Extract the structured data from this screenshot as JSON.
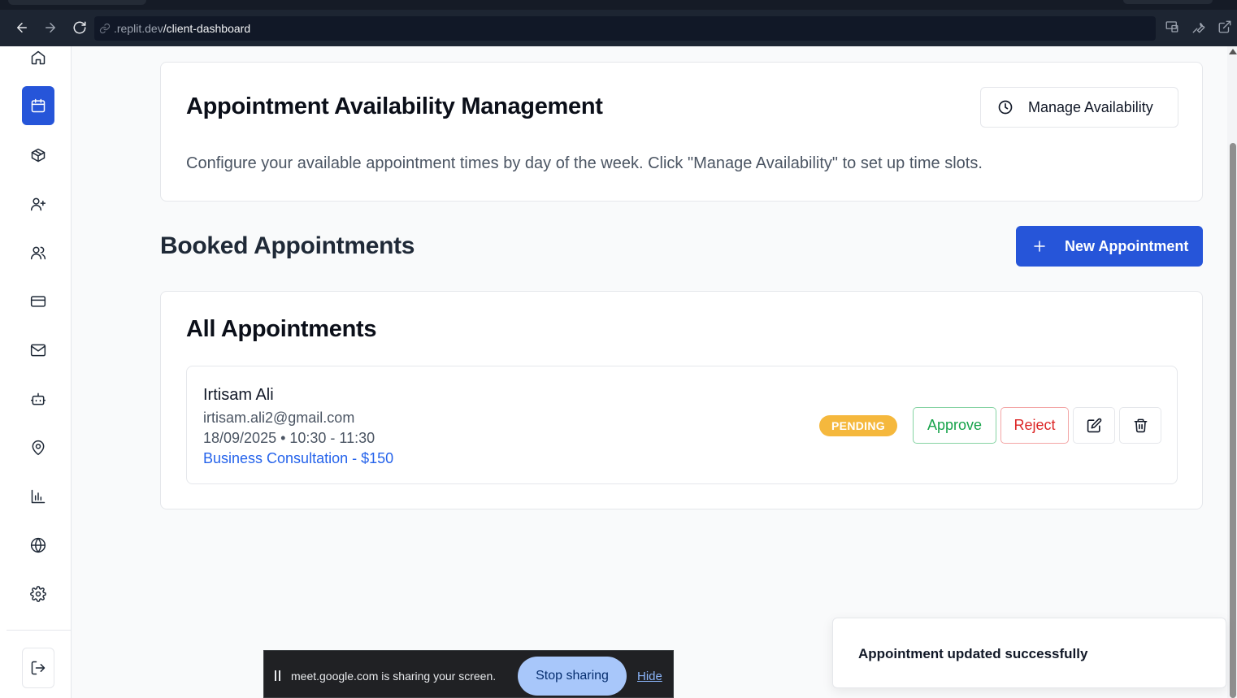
{
  "browser": {
    "url_host": ".replit.dev",
    "url_path": "/client-dashboard"
  },
  "sidebar": {
    "items": [
      {
        "icon": "home-icon",
        "active": false
      },
      {
        "icon": "calendar-icon",
        "active": true
      },
      {
        "icon": "package-icon",
        "active": false
      },
      {
        "icon": "user-plus-icon",
        "active": false
      },
      {
        "icon": "users-icon",
        "active": false
      },
      {
        "icon": "credit-card-icon",
        "active": false
      },
      {
        "icon": "mail-icon",
        "active": false
      },
      {
        "icon": "bot-icon",
        "active": false
      },
      {
        "icon": "map-pin-icon",
        "active": false
      },
      {
        "icon": "bar-chart-icon",
        "active": false
      },
      {
        "icon": "globe-icon",
        "active": false
      },
      {
        "icon": "settings-icon",
        "active": false
      }
    ],
    "logout_icon": "logout-icon"
  },
  "availability": {
    "title": "Appointment Availability Management",
    "description": "Configure your available appointment times by day of the week. Click \"Manage Availability\" to set up time slots.",
    "manage_button": "Manage Availability"
  },
  "booked": {
    "title": "Booked Appointments",
    "new_button": "New Appointment"
  },
  "all_appointments": {
    "title": "All Appointments",
    "items": [
      {
        "name": "Irtisam Ali",
        "email": "irtisam.ali2@gmail.com",
        "datetime": "18/09/2025 • 10:30 - 11:30",
        "service": "Business Consultation - $150",
        "status": "PENDING",
        "approve_label": "Approve",
        "reject_label": "Reject"
      }
    ]
  },
  "toast": {
    "message": "Appointment updated successfully"
  },
  "screen_share": {
    "message": "meet.google.com is sharing your screen.",
    "stop_label": "Stop sharing",
    "hide_label": "Hide"
  },
  "colors": {
    "primary": "#2655d9",
    "pending": "#f5b83d",
    "approve": "#16a34a",
    "reject": "#dc2626",
    "link": "#2563eb"
  }
}
